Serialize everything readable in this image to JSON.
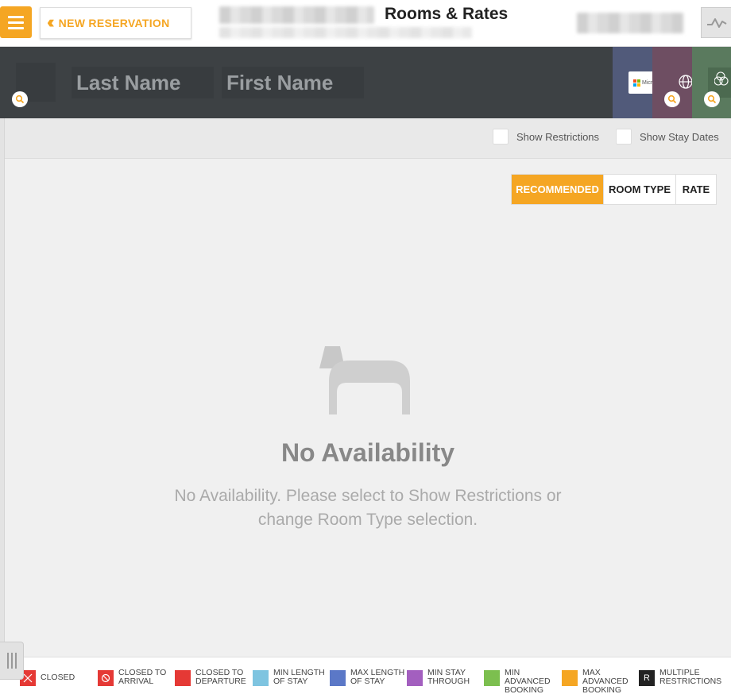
{
  "header": {
    "back_label": "NEW RESERVATION",
    "title": "Rooms & Rates",
    "menu_icon": "hamburger-icon",
    "back_icon": "double-chevron-left-icon",
    "activity_icon": "activity-line-icon",
    "accent_color": "#f5a623"
  },
  "guest": {
    "last_name_placeholder": "Last Name",
    "first_name_placeholder": "First Name",
    "card_colors": [
      "#515a7a",
      "#6e4e62",
      "#5a7a5e"
    ]
  },
  "options": {
    "show_restrictions": "Show Restrictions",
    "show_stay_dates": "Show Stay Dates"
  },
  "sort_tabs": [
    {
      "label": "RECOMMENDED",
      "active": true
    },
    {
      "label": "ROOM TYPE",
      "active": false
    },
    {
      "label": "RATE",
      "active": false
    }
  ],
  "empty_state": {
    "icon": "bed-icon",
    "title": "No Availability",
    "line1": "No Availability. Please select to Show Restrictions or",
    "line2": "change Room Type selection."
  },
  "legend": [
    {
      "label": "CLOSED",
      "color": "#e53935"
    },
    {
      "label": "CLOSED TO ARRIVAL",
      "color": "#e53935"
    },
    {
      "label": "CLOSED TO DEPARTURE",
      "color": "#e53935"
    },
    {
      "label": "MIN LENGTH OF STAY",
      "color": "#7ec4e0"
    },
    {
      "label": "MAX LENGTH OF STAY",
      "color": "#5b78c7"
    },
    {
      "label": "MIN STAY THROUGH",
      "color": "#a35fbf"
    },
    {
      "label": "MIN ADVANCED BOOKING",
      "color": "#7cbf4f"
    },
    {
      "label": "MAX ADVANCED BOOKING",
      "color": "#f5a623"
    },
    {
      "label": "MULTIPLE RESTRICTIONS",
      "color": "#222222",
      "mark": "R"
    }
  ]
}
